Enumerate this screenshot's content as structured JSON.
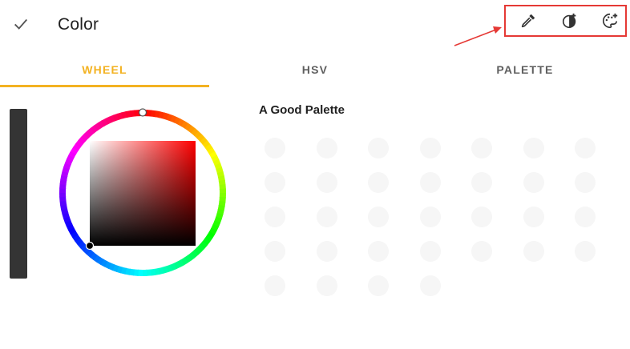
{
  "header": {
    "title": "Color",
    "confirm_icon": "check-icon",
    "actions": [
      {
        "icon": "eyedropper-icon"
      },
      {
        "icon": "color-add-icon"
      },
      {
        "icon": "palette-add-icon"
      }
    ]
  },
  "tabs": [
    {
      "label": "WHEEL",
      "active": true
    },
    {
      "label": "HSV",
      "active": false
    },
    {
      "label": "PALETTE",
      "active": false
    }
  ],
  "palette": {
    "name": "A Good Palette",
    "swatch_count": 32
  },
  "colors": {
    "accent": "#f3b221",
    "highlight_box": "#e53935",
    "brightness_slider": "#343434",
    "selected_hue": "#ff0000"
  }
}
